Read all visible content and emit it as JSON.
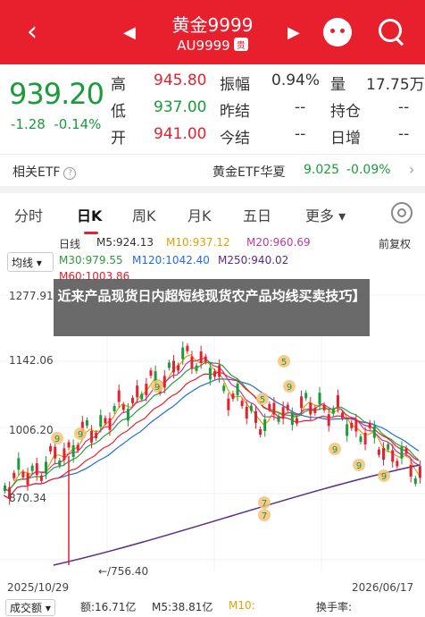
{
  "header": {
    "title": "黄金9999",
    "subtitle": "AU9999",
    "badge": "贵"
  },
  "quote": {
    "price": "939.20",
    "change": "-1.28",
    "change_pct": "-0.14%",
    "labels": [
      "高",
      "低",
      "开",
      "振幅",
      "昨结",
      "今结",
      "量",
      "持仓",
      "日增"
    ],
    "values": {
      "high": "945.80",
      "low": "937.00",
      "open": "941.00",
      "amp": "0.94%",
      "prev_settle": "--",
      "settle": "--",
      "volume": "17.75万",
      "open_interest": "--",
      "daily_add": "--"
    }
  },
  "etf": {
    "label": "相关ETF",
    "name": "黄金ETF华夏",
    "value": "9.025",
    "change": "-0.09%"
  },
  "tabs": [
    "分时",
    "日K",
    "周K",
    "月K",
    "五日",
    "更多"
  ],
  "indicators": {
    "line1": [
      "日线",
      "M5:924.13",
      "M10:937.12",
      "M20:960.69"
    ],
    "line2": [
      "M30:979.55",
      "M120:1042.40",
      "M250:940.02"
    ],
    "line3": [
      "M60:1003.86"
    ],
    "select": "均线",
    "fq": "前复权"
  },
  "chart": {
    "y_ticks": [
      "1277.91",
      "1142.06",
      "1006.20",
      "870.34"
    ],
    "low_label": "756.40",
    "x_ticks": [
      "2025/10/29",
      "2026/06/17"
    ],
    "markers": [
      "9",
      "9",
      "9",
      "5",
      "5",
      "9",
      "7",
      "7",
      "9",
      "9",
      "9"
    ]
  },
  "overlay": "近来产品现货日内超短线现货农产品均线买卖技巧】",
  "bottom": {
    "select": "成交额",
    "vol": "额:16.71亿",
    "m5": "M5:38.81亿",
    "m10": "M10:",
    "rate": "换手率:"
  },
  "colors": {
    "accent": "#e8202e",
    "down": "#1a9b3c",
    "up": "#e8202e"
  },
  "chart_data": {
    "type": "candlestick",
    "x": [
      "2025/10/29",
      "2026/06/17"
    ],
    "ylim": [
      756.4,
      1277.91
    ],
    "series": [
      {
        "name": "日线",
        "values": []
      }
    ]
  }
}
